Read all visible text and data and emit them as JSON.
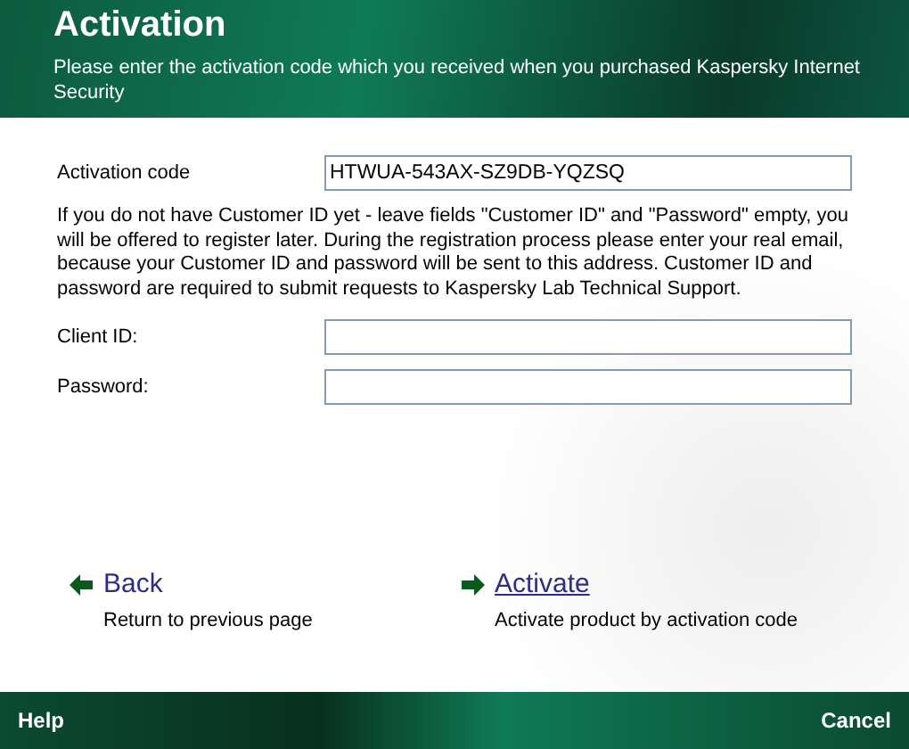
{
  "header": {
    "title": "Activation",
    "subtitle": "Please enter the activation code which you received when you purchased Kaspersky Internet Security"
  },
  "activation_field": {
    "label": "Activation code",
    "value": "HTWUA-543AX-SZ9DB-YQZSQ"
  },
  "note": "If you do not have Customer ID yet - leave fields \"Customer ID\" and \"Password\" empty, you will be offered to register later. During the registration process please enter your real email, because your Customer ID and password will be sent to this address. Customer ID and password are required to submit requests to Kaspersky Lab Technical Support.",
  "fields": [
    {
      "label": "Client ID:"
    },
    {
      "label": "Password:"
    }
  ],
  "actions": [
    {
      "label": "Back",
      "description": "Return to previous page",
      "hovered": false
    },
    {
      "label": "Activate",
      "description": "Activate product by activation code",
      "hovered": true
    }
  ],
  "footer": {
    "help": "Help",
    "cancel": "Cancel"
  }
}
